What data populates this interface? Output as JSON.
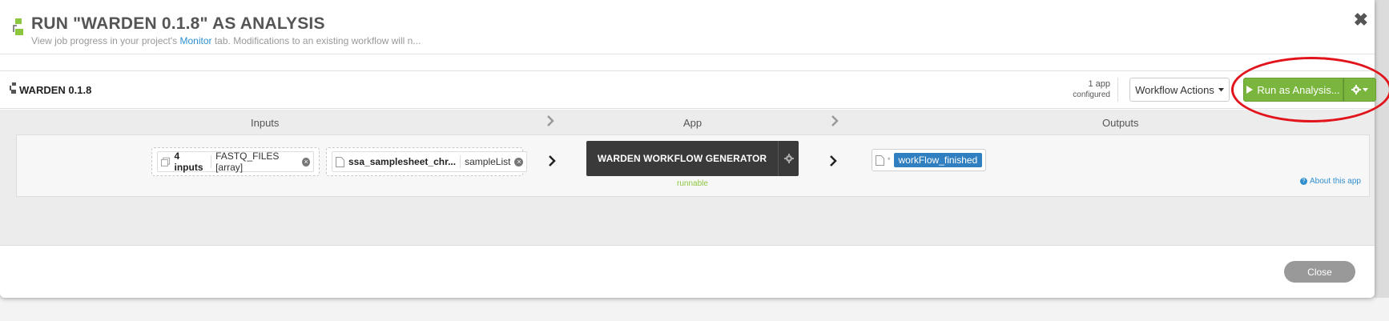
{
  "modal": {
    "title": "RUN \"WARDEN 0.1.8\" AS ANALYSIS",
    "subtitle_before": "View job progress in your project's ",
    "subtitle_link": "Monitor",
    "subtitle_after": " tab. Modifications to an existing workflow will n...",
    "close_glyph": "✖"
  },
  "workflow": {
    "name": "WARDEN 0.1.8",
    "app_count": "1 app",
    "configured": "configured",
    "actions_label": "Workflow Actions",
    "run_label": "Run as Analysis..."
  },
  "columns": {
    "inputs": "Inputs",
    "app": "App",
    "outputs": "Outputs"
  },
  "inputs": [
    {
      "bold": "4 inputs",
      "field": "FASTQ_FILES [array]"
    },
    {
      "bold": "ssa_samplesheet_chr...",
      "field": "sampleList"
    }
  ],
  "app": {
    "name": "WARDEN WORKFLOW GENERATOR",
    "status": "runnable"
  },
  "outputs": [
    {
      "label": "workFlow_finished"
    }
  ],
  "about_link": "About this app",
  "footer": {
    "close_label": "Close"
  },
  "colors": {
    "accent_green": "#7ab53d",
    "link_blue": "#2f8fce",
    "annotation_red": "#e2141b"
  }
}
